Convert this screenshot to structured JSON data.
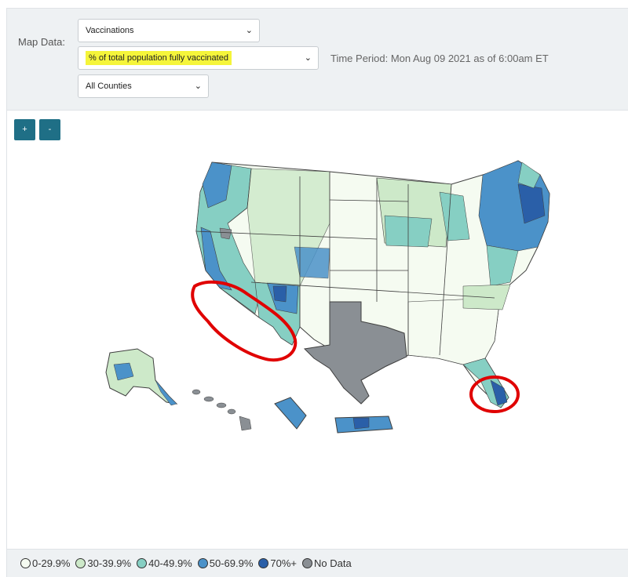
{
  "controls": {
    "map_data_label": "Map Data:",
    "dataset_select": "Vaccinations",
    "metric_select": "% of total population fully vaccinated",
    "scope_select": "All Counties",
    "time_period": "Time Period: Mon Aug 09 2021 as of 6:00am ET"
  },
  "zoom": {
    "in_label": "+",
    "out_label": "-"
  },
  "colors": {
    "band_0_29": "#f5fbf1",
    "band_30_39": "#cde9c9",
    "band_40_49": "#86cfc3",
    "band_50_69": "#4b92c9",
    "band_70_plus": "#2a5fa8",
    "no_data": "#8a8f94",
    "annotation": "#e00000",
    "highlight": "#f5f53a"
  },
  "legend": [
    {
      "label": "0-29.9%",
      "color": "#f5fbf1"
    },
    {
      "label": "30-39.9%",
      "color": "#cde9c9"
    },
    {
      "label": "40-49.9%",
      "color": "#86cfc3"
    },
    {
      "label": "50-69.9%",
      "color": "#4b92c9"
    },
    {
      "label": "70%+",
      "color": "#2a5fa8"
    },
    {
      "label": "No Data",
      "color": "#8a8f94"
    }
  ]
}
